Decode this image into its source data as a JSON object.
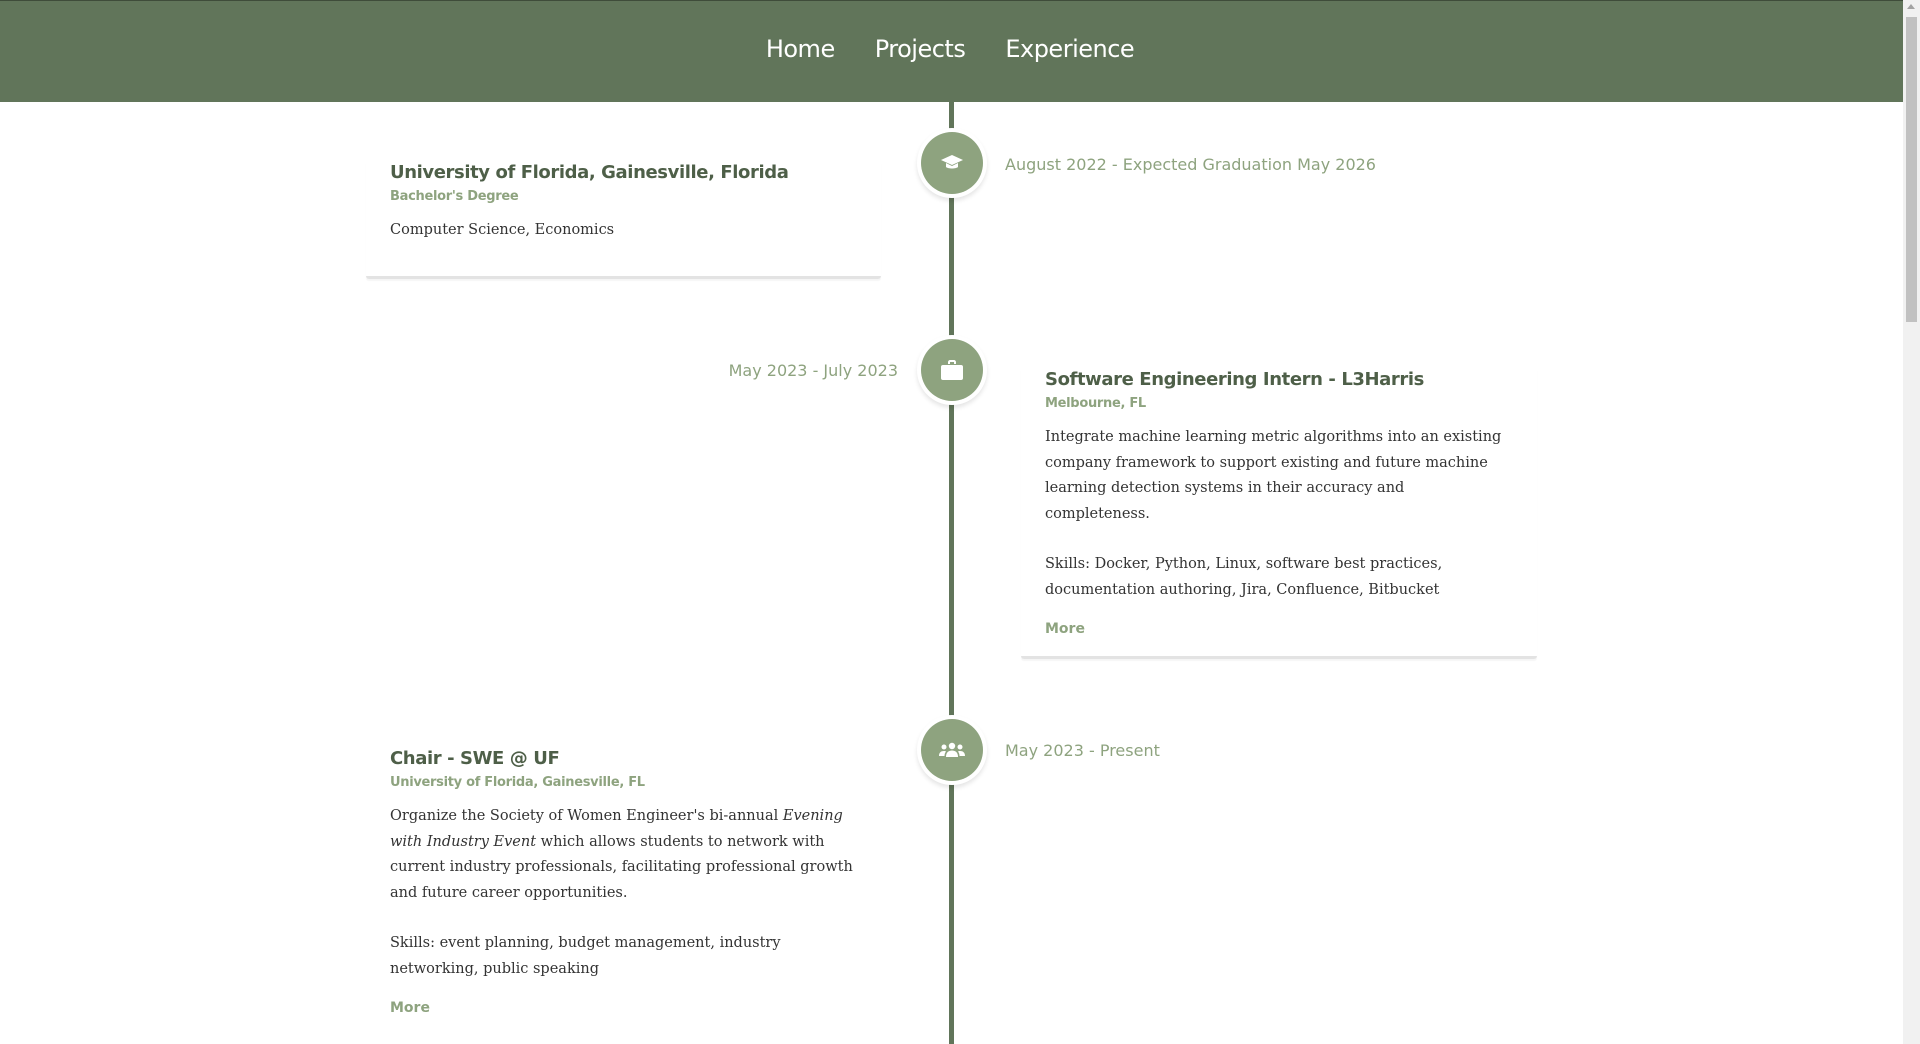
{
  "nav": {
    "home": "Home",
    "projects": "Projects",
    "experience": "Experience"
  },
  "colors": {
    "header": "#61755a",
    "accent": "#8ea37f",
    "title": "#4e5f48"
  },
  "timeline": [
    {
      "icon": "graduation-cap-icon",
      "date": "August 2022 - Expected Graduation May 2026",
      "title": "University of Florida, Gainesville, Florida",
      "subtitle": "Bachelor's Degree",
      "description": "Computer Science, Economics"
    },
    {
      "icon": "briefcase-icon",
      "date": "May 2023 - July 2023",
      "title": "Software Engineering Intern - L3Harris",
      "subtitle": "Melbourne, FL",
      "description": "Integrate machine learning metric algorithms into an existing company framework to support existing and future machine learning detection systems in their accuracy and completeness.",
      "skills": "Skills: Docker, Python, Linux, software best practices, documentation authoring, Jira, Confluence, Bitbucket",
      "more": "More"
    },
    {
      "icon": "people-group-icon",
      "date": "May 2023 - Present",
      "title": "Chair - SWE @ UF",
      "subtitle": "University of Florida, Gainesville, FL",
      "description_before": "Organize the Society of Women Engineer's bi-annual ",
      "description_em": "Evening with Industry Event",
      "description_after": " which allows students to network with current industry professionals, facilitating professional growth and future career opportunities.",
      "skills": "Skills: event planning, budget management, industry networking, public speaking",
      "more": "More"
    }
  ]
}
